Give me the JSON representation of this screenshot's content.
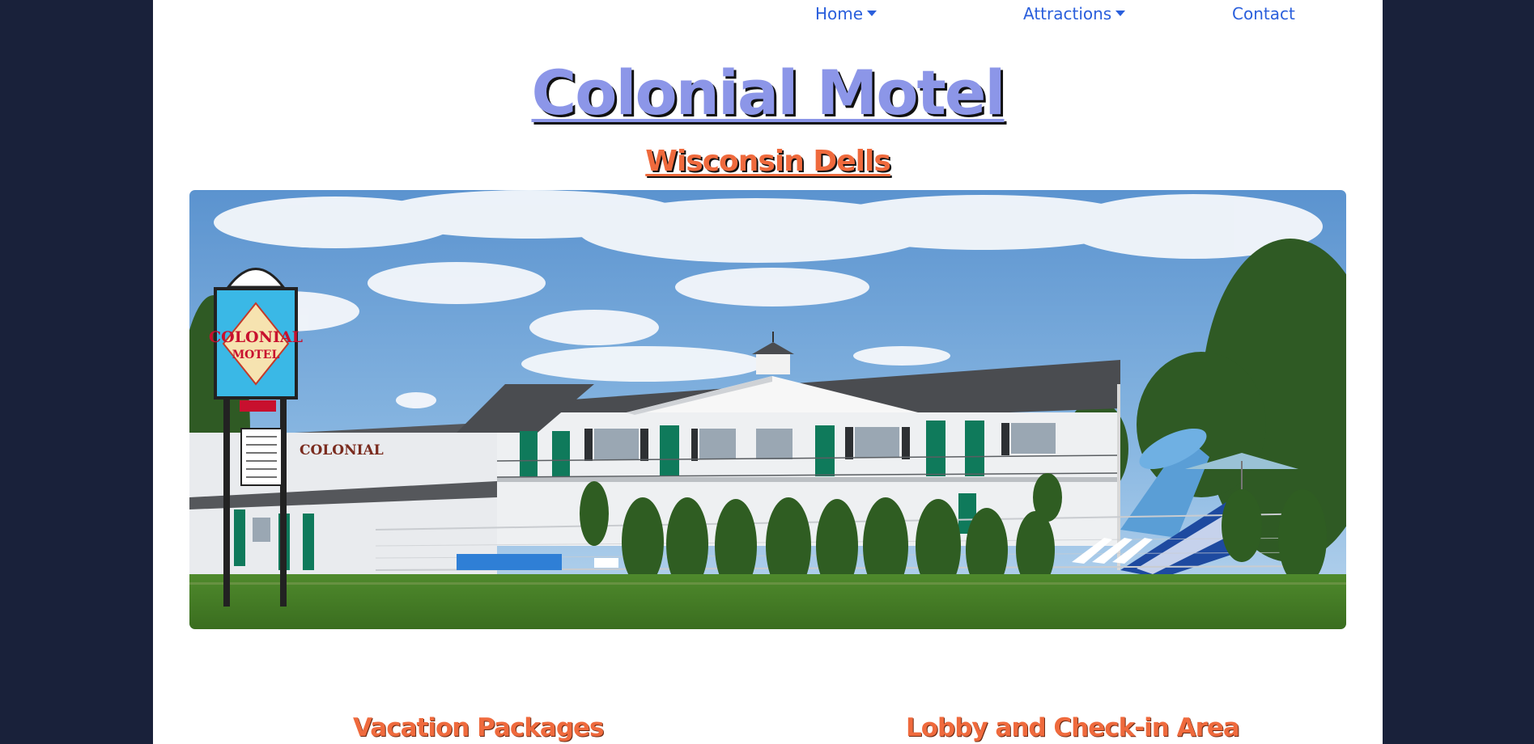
{
  "nav": {
    "items": [
      {
        "label": "Home",
        "dropdown": true
      },
      {
        "label": "Attractions",
        "dropdown": true
      },
      {
        "label": "Contact",
        "dropdown": false
      }
    ]
  },
  "header": {
    "title": "Colonial Motel",
    "subtitle": "Wisconsin Dells"
  },
  "hero": {
    "building_sign": "COLONIAL",
    "pole_sign_line1": "COLONIAL",
    "pole_sign_line2": "MOTEL"
  },
  "sections": [
    {
      "heading": "Vacation Packages"
    },
    {
      "heading": "Lobby and Check-in Area"
    }
  ],
  "colors": {
    "page_background": "#19213a",
    "content_background": "#ffffff",
    "nav_link": "#2a5fdc",
    "title": "#8c96e8",
    "accent": "#ef6a3d"
  }
}
